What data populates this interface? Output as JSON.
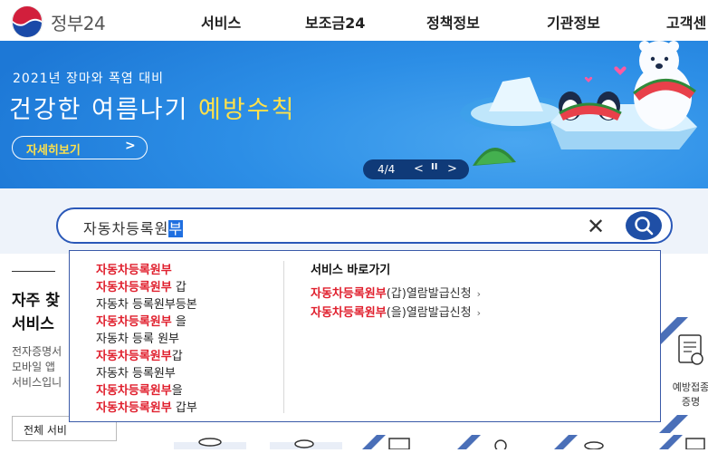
{
  "header": {
    "logo_text": "정부24",
    "nav": [
      "서비스",
      "보조금24",
      "정책정보",
      "기관정보",
      "고객센"
    ]
  },
  "banner": {
    "line1": "2021년 장마와 폭염 대비",
    "line2_main": "건강한 여름나기 ",
    "line2_highlight": "예방수칙",
    "more_label": "자세히보기",
    "more_arrow": ">",
    "pager_count": "4/4",
    "pager_prev": "<",
    "pager_pause": "II",
    "pager_next": ">"
  },
  "search": {
    "query_typed": "자동차등록원",
    "query_selected": "부",
    "clear_glyph": "✕"
  },
  "dropdown": {
    "suggestions": [
      {
        "match": "자동차등록원부",
        "rest": ""
      },
      {
        "match": "자동차등록원부",
        "rest": " 갑"
      },
      {
        "match": "",
        "rest": "자동차 등록원부등본"
      },
      {
        "match": "자동차등록원부",
        "rest": " 을"
      },
      {
        "match": "",
        "rest": "자동차 등록 원부"
      },
      {
        "match": "자동차등록원부",
        "rest": "갑"
      },
      {
        "match": "",
        "rest": "자동차 등록원부"
      },
      {
        "match": "자동차등록원부",
        "rest": "을"
      },
      {
        "match": "자동차등록원부",
        "rest": " 갑부"
      }
    ],
    "shortcut_title": "서비스 바로가기",
    "shortcuts": [
      {
        "match": "자동차등록원부",
        "rest": "(갑)열람발급신청",
        "chev": "›"
      },
      {
        "match": "자동차등록원부",
        "rest": "(을)열람발급신청",
        "chev": "›"
      }
    ]
  },
  "left": {
    "heading_line1": "자주 찾",
    "heading_line2": "서비스",
    "desc_line1": "전자증명서",
    "desc_line2": "모바일 앱",
    "desc_line3": "서비스입니",
    "all_button": "전체 서비"
  },
  "right_card": {
    "label_line1": "예방접종",
    "label_line2": "증명"
  },
  "colors": {
    "brand_blue": "#1f4fa6",
    "banner_blue": "#1e7bd8",
    "highlight_yellow": "#ffe14a",
    "match_red": "#e0202e"
  }
}
